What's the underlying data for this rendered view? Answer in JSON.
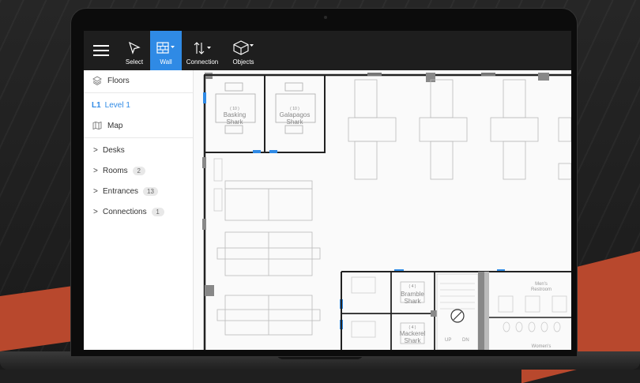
{
  "toolbar": {
    "menu_icon": "hamburger-menu-icon",
    "tools": [
      {
        "label": "Select",
        "icon": "cursor-arrow-icon",
        "active": false
      },
      {
        "label": "Wall",
        "icon": "wall-grid-icon",
        "active": true
      },
      {
        "label": "Connection",
        "icon": "up-down-arrows-icon",
        "active": false
      },
      {
        "label": "Objects",
        "icon": "cube-icon",
        "active": false
      }
    ]
  },
  "sidebar": {
    "floors_label": "Floors",
    "level": {
      "code": "L1",
      "name": "Level 1"
    },
    "map_label": "Map",
    "groups": [
      {
        "label": "Desks",
        "count": null
      },
      {
        "label": "Rooms",
        "count": "2"
      },
      {
        "label": "Entrances",
        "count": "13"
      },
      {
        "label": "Connections",
        "count": "1"
      }
    ]
  },
  "map": {
    "rooms": [
      {
        "capacity": "( 10 )",
        "name_line1": "Basking",
        "name_line2": "Shark"
      },
      {
        "capacity": "( 10 )",
        "name_line1": "Galapagos",
        "name_line2": "Shark"
      },
      {
        "capacity": "( 4 )",
        "name_line1": "Bramble",
        "name_line2": "Shark"
      },
      {
        "capacity": "( 4 )",
        "name_line1": "Mackerel",
        "name_line2": "Shark"
      }
    ],
    "restrooms": {
      "mens_line1": "Men's",
      "mens_line2": "Restroom",
      "womens": "Women's"
    },
    "stairs": {
      "up": "UP",
      "down": "DN"
    }
  },
  "colors": {
    "accent": "#2f8ae5",
    "toolbar_bg": "#1e1e1e",
    "decor_orange": "#b8482d"
  }
}
